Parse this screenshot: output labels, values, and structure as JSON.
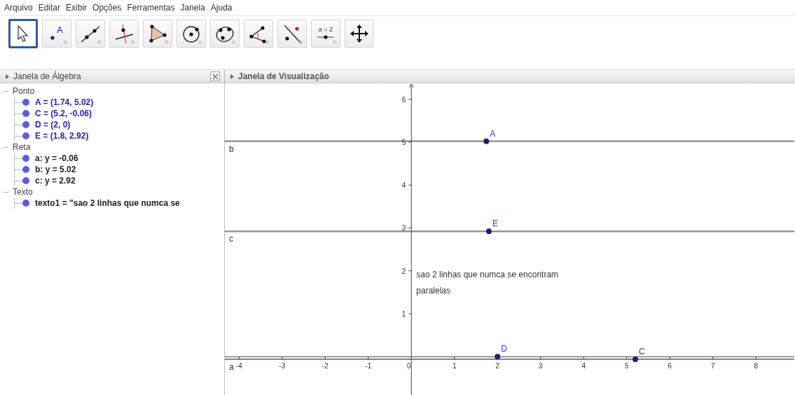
{
  "menu_bar": [
    "Arquivo",
    "Editar",
    "Exibir",
    "Opções",
    "Ferramentas",
    "Janela",
    "Ajuda"
  ],
  "toolbar": [
    {
      "kind": "move",
      "selected": true
    },
    {
      "kind": "point",
      "label": "A",
      "selected": false
    },
    {
      "kind": "line",
      "selected": false
    },
    {
      "kind": "perpendicular",
      "selected": false
    },
    {
      "kind": "polygon",
      "selected": false
    },
    {
      "kind": "circle",
      "selected": false
    },
    {
      "kind": "conic",
      "selected": false
    },
    {
      "kind": "angle",
      "selected": false
    },
    {
      "kind": "reflect",
      "selected": false
    },
    {
      "kind": "slider",
      "label": "a = 2",
      "selected": false
    },
    {
      "kind": "pan",
      "selected": false
    }
  ],
  "algebra_view": {
    "title": "Janela de Álgebra",
    "groups": [
      {
        "label": "Ponto",
        "children": [
          {
            "text": "A = (1.74, 5.02)",
            "color": "#2424c8"
          },
          {
            "text": "C = (5.2, -0.06)",
            "color": "#2424c8"
          },
          {
            "text": "D = (2, 0)",
            "color": "#2424c8"
          },
          {
            "text": "E = (1.8, 2.92)",
            "color": "#2424c8"
          }
        ]
      },
      {
        "label": "Reta",
        "children": [
          {
            "text": "a: y = -0.06",
            "color": "#222222"
          },
          {
            "text": "b: y = 5.02",
            "color": "#222222"
          },
          {
            "text": "c: y = 2.92",
            "color": "#222222"
          }
        ]
      },
      {
        "label": "Texto",
        "children": [
          {
            "text": "texto1 = \"sao 2 linhas que numca se",
            "color": "#222222"
          }
        ]
      }
    ]
  },
  "graphics_view": {
    "title": "Janela de Visualização",
    "chart_data": {
      "type": "scatter",
      "xlim": [
        -4.33,
        8.89
      ],
      "ylim": [
        -0.91,
        6.37
      ],
      "xticks": [
        -4,
        -3,
        -2,
        -1,
        0,
        1,
        2,
        3,
        4,
        5,
        6,
        7,
        8
      ],
      "yticks": [
        1,
        2,
        3,
        4,
        5,
        6
      ],
      "x": [
        1.74,
        5.2,
        2,
        1.8
      ],
      "series": [
        {
          "color": "#1c1c7a",
          "values": [
            5.02,
            -0.06,
            0,
            2.92
          ]
        }
      ],
      "value_labels": [
        "A",
        "C",
        "D",
        "E"
      ],
      "ref_lines": [
        {
          "axis": "y",
          "value": -0.06,
          "label": "a"
        },
        {
          "axis": "y",
          "value": 5.02,
          "label": "b"
        },
        {
          "axis": "y",
          "value": 2.92,
          "label": "c"
        }
      ],
      "annotations": [
        "sao 2 linhas que numca se encontram",
        "paralelas"
      ]
    }
  }
}
